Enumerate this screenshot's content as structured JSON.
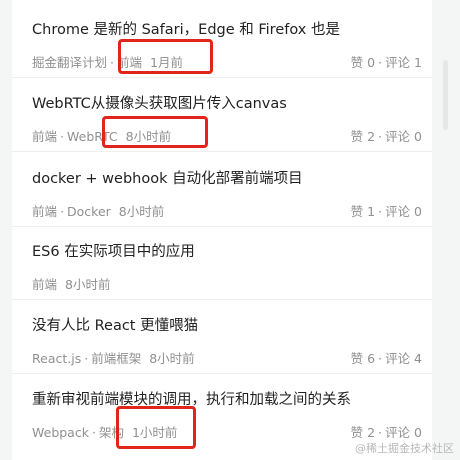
{
  "articles": [
    {
      "title": "Chrome 是新的 Safari，Edge 和 Firefox 也是",
      "tags": [
        "掘金翻译计划",
        "前端"
      ],
      "time": "1月前",
      "likes": "赞 0",
      "comments": "评论 1"
    },
    {
      "title": "WebRTC从摄像头获取图片传入canvas",
      "tags": [
        "前端",
        "WebRTC"
      ],
      "time": "8小时前",
      "likes": "赞 2",
      "comments": "评论 0"
    },
    {
      "title": "docker + webhook 自动化部署前端项目",
      "tags": [
        "前端",
        "Docker"
      ],
      "time": "8小时前",
      "likes": "赞 1",
      "comments": "评论 0"
    },
    {
      "title": "ES6 在实际项目中的应用",
      "tags": [
        "前端"
      ],
      "time": "8小时前",
      "likes": "",
      "comments": ""
    },
    {
      "title": "没有人比 React 更懂喂猫",
      "tags": [
        "React.js",
        "前端框架"
      ],
      "time": "8小时前",
      "likes": "赞 6",
      "comments": "评论 4"
    },
    {
      "title": "重新审视前端模块的调用，执行和加载之间的关系",
      "tags": [
        "Webpack",
        "架构"
      ],
      "time": "1小时前",
      "likes": "赞 2",
      "comments": "评论 0"
    }
  ],
  "watermark": "@稀土掘金技术社区",
  "colors": {
    "highlight": "#e1251b",
    "meta": "#909090",
    "title": "#222222"
  }
}
